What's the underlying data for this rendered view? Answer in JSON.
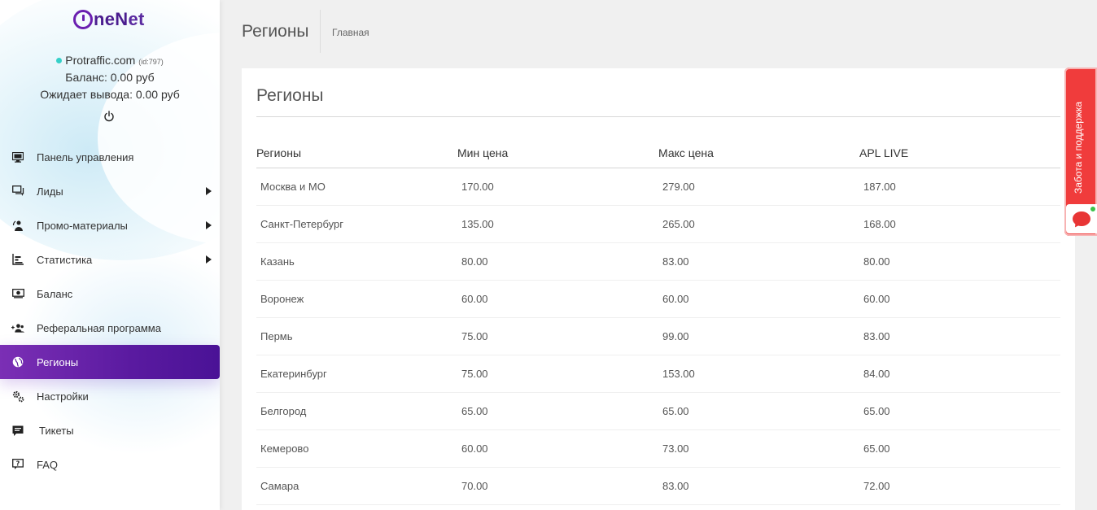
{
  "brand": {
    "logo_prefix": "O",
    "logo_text1": "ne",
    "logo_text2": "N",
    "logo_text3": "et"
  },
  "user": {
    "site": "Protraffic.com",
    "id_label": "(id:797)",
    "balance": "Баланс: 0.00 руб",
    "pending": "Ожидает вывода: 0.00 руб",
    "status_color": "#35d0c8"
  },
  "sidebar": {
    "items": [
      {
        "label": "Панель управления",
        "icon": "monitor-icon",
        "has_arrow": false,
        "active": false
      },
      {
        "label": "Лиды",
        "icon": "chat-icon",
        "has_arrow": true,
        "active": false
      },
      {
        "label": "Промо-материалы",
        "icon": "promo-icon",
        "has_arrow": true,
        "active": false
      },
      {
        "label": "Статистика",
        "icon": "stats-icon",
        "has_arrow": true,
        "active": false
      },
      {
        "label": "Баланс",
        "icon": "money-icon",
        "has_arrow": false,
        "active": false
      },
      {
        "label": "Реферальная программа",
        "icon": "referral-icon",
        "has_arrow": false,
        "active": false
      },
      {
        "label": "Регионы",
        "icon": "globe-icon",
        "has_arrow": false,
        "active": true
      },
      {
        "label": "Настройки",
        "icon": "gears-icon",
        "has_arrow": false,
        "active": false
      },
      {
        "label": "Тикеты",
        "icon": "ticket-icon",
        "has_arrow": false,
        "active": false
      },
      {
        "label": "FAQ",
        "icon": "faq-icon",
        "has_arrow": false,
        "active": false
      }
    ],
    "active_gradient": [
      "#7b2fb5",
      "#4a1296"
    ]
  },
  "header": {
    "title": "Регионы",
    "breadcrumb": "Главная"
  },
  "card": {
    "title": "Регионы"
  },
  "table": {
    "columns": [
      "Регионы",
      "Мин цена",
      "Макс цена",
      "APL LIVE"
    ],
    "rows": [
      [
        "Москва и МО",
        "170.00",
        "279.00",
        "187.00"
      ],
      [
        "Санкт-Петербург",
        "135.00",
        "265.00",
        "168.00"
      ],
      [
        "Казань",
        "80.00",
        "83.00",
        "80.00"
      ],
      [
        "Воронеж",
        "60.00",
        "60.00",
        "60.00"
      ],
      [
        "Пермь",
        "75.00",
        "99.00",
        "83.00"
      ],
      [
        "Екатеринбург",
        "75.00",
        "153.00",
        "84.00"
      ],
      [
        "Белгород",
        "65.00",
        "65.00",
        "65.00"
      ],
      [
        "Кемерово",
        "60.00",
        "73.00",
        "65.00"
      ],
      [
        "Самара",
        "70.00",
        "83.00",
        "72.00"
      ]
    ]
  },
  "support": {
    "label": "Забота и поддержка",
    "accent": "#f03c3c"
  }
}
